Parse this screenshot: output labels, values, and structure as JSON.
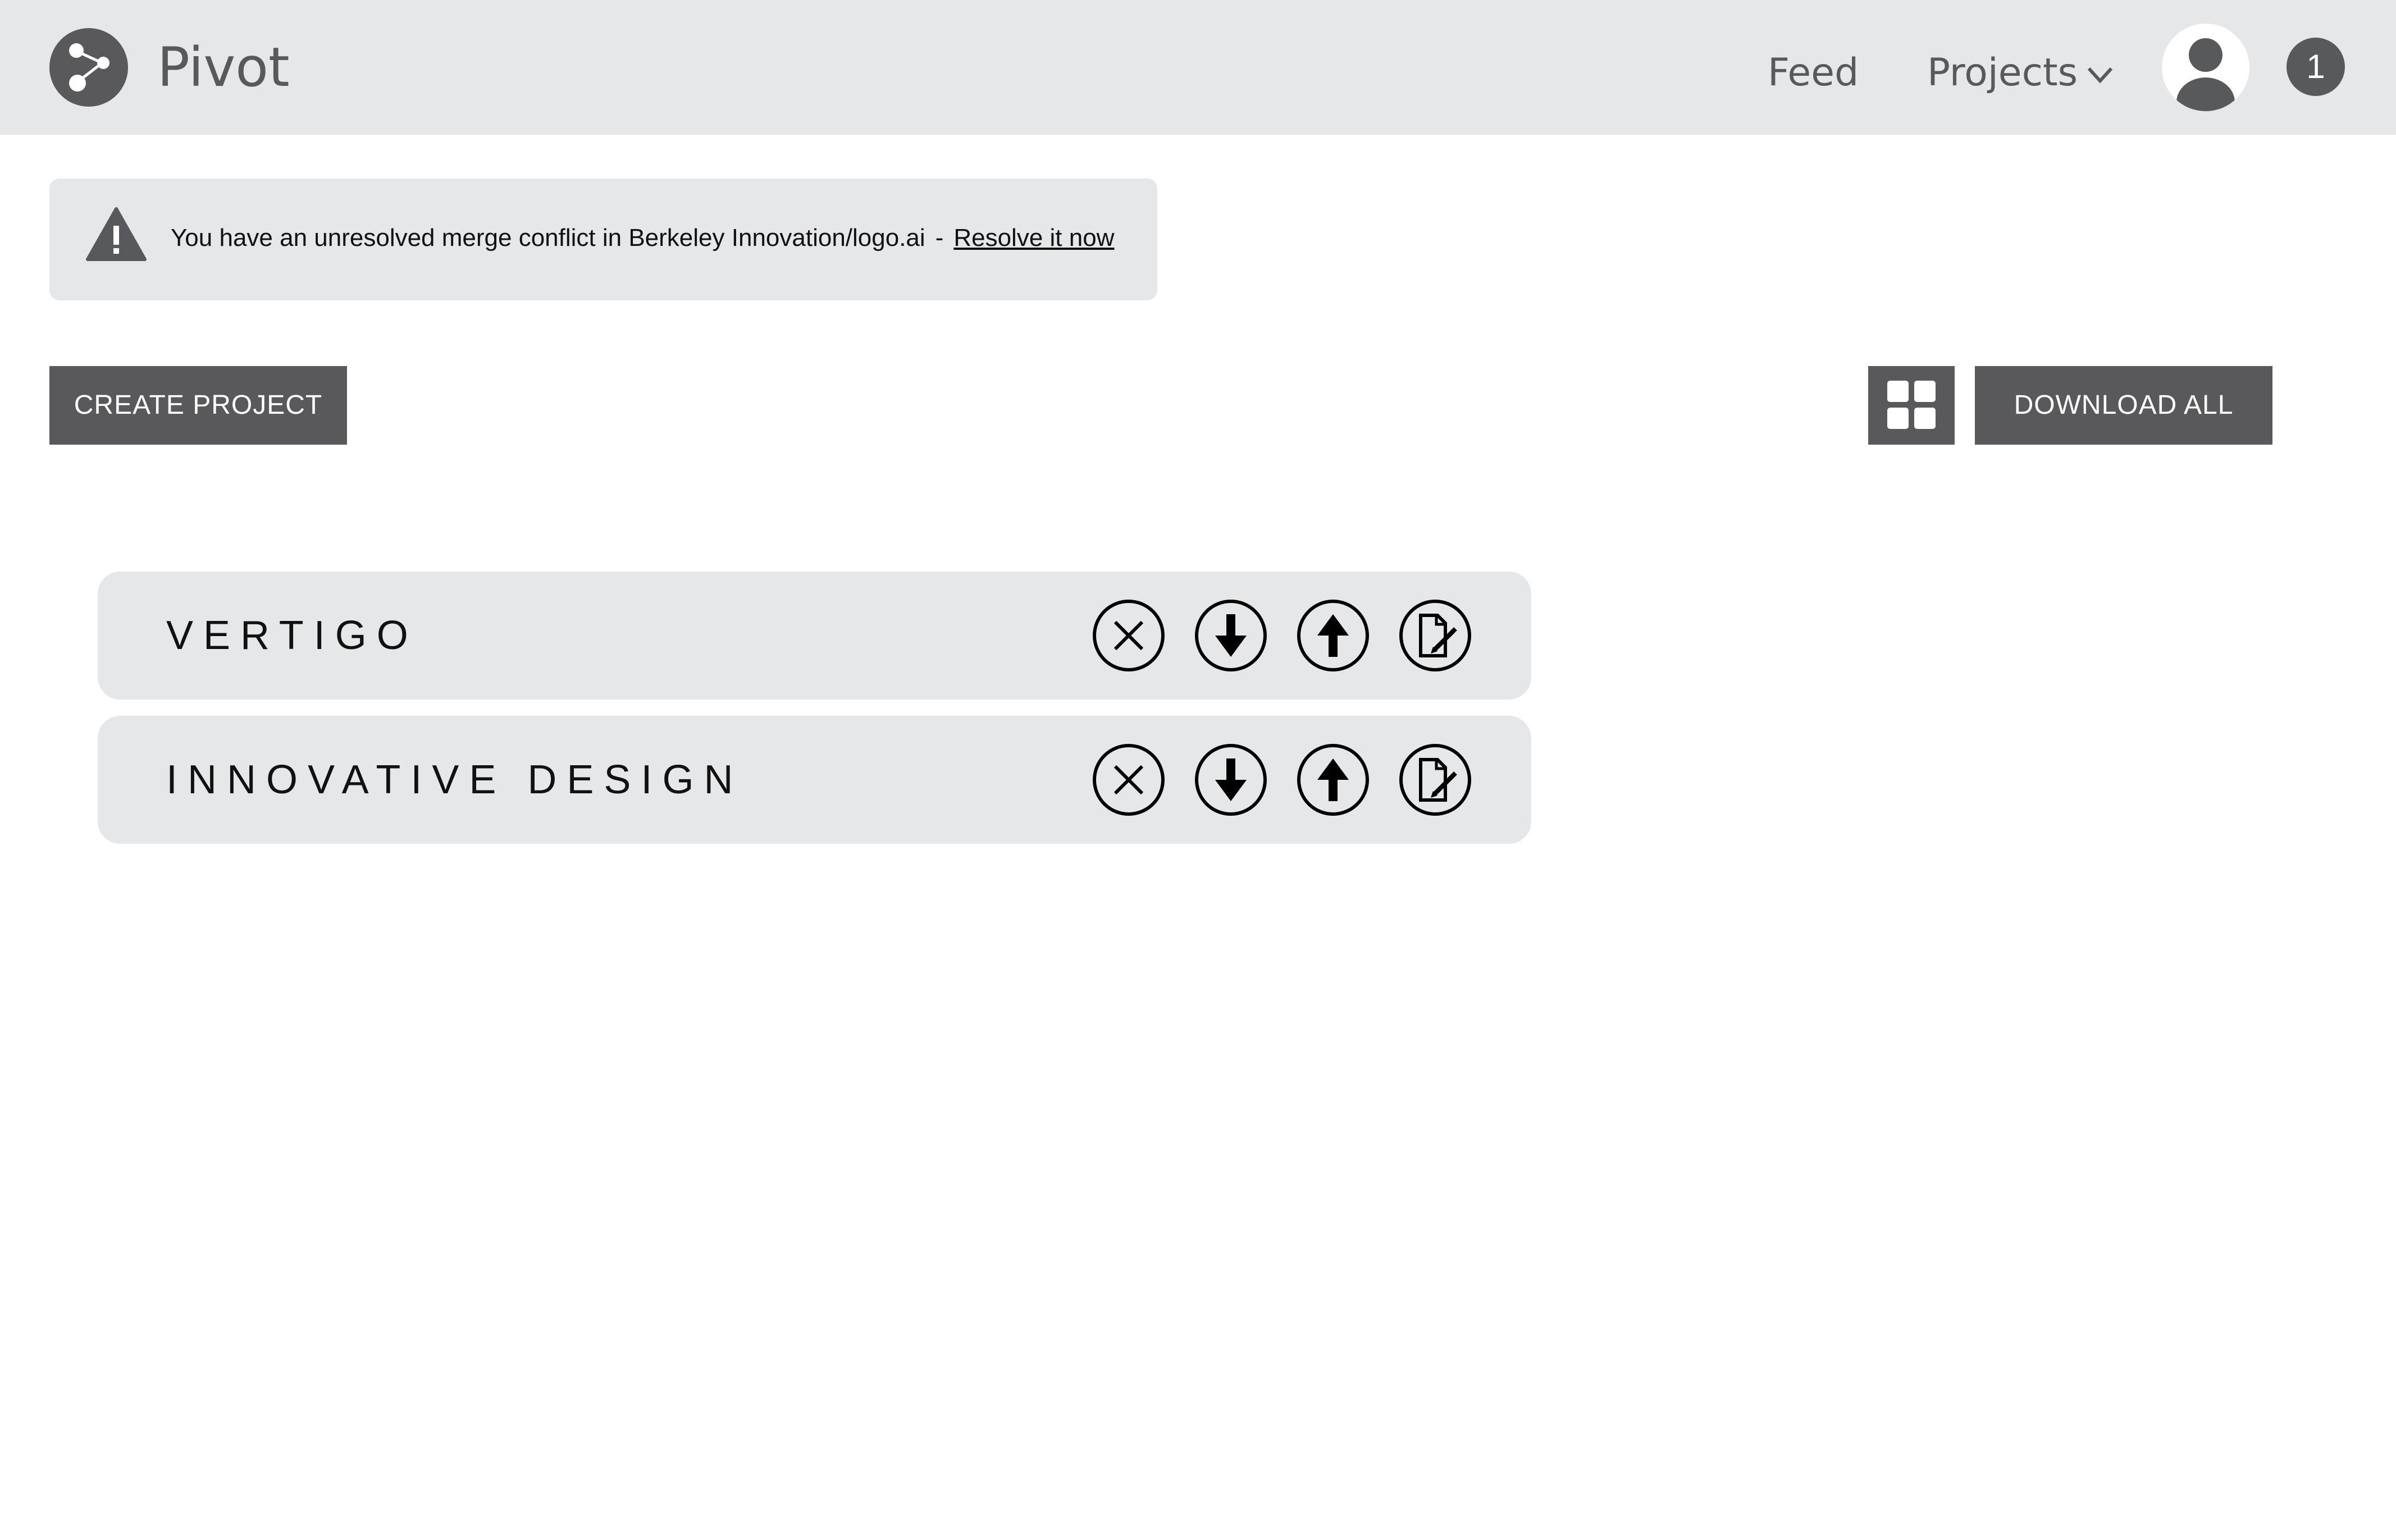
{
  "header": {
    "brand": "Pivot",
    "nav": {
      "feed": "Feed",
      "projects": "Projects"
    },
    "notification_count": "1"
  },
  "alert": {
    "message": "You have an unresolved merge conflict in Berkeley Innovation/logo.ai",
    "separator": "-",
    "link_label": "Resolve it now"
  },
  "toolbar": {
    "create_label": "CREATE PROJECT",
    "download_all_label": "DOWNLOAD ALL"
  },
  "projects": [
    {
      "name": "VERTIGO"
    },
    {
      "name": "INNOVATIVE DESIGN"
    }
  ],
  "colors": {
    "header_bg": "#e6e7e9",
    "button_bg": "#59595b",
    "card_bg": "#e6e7e9"
  }
}
